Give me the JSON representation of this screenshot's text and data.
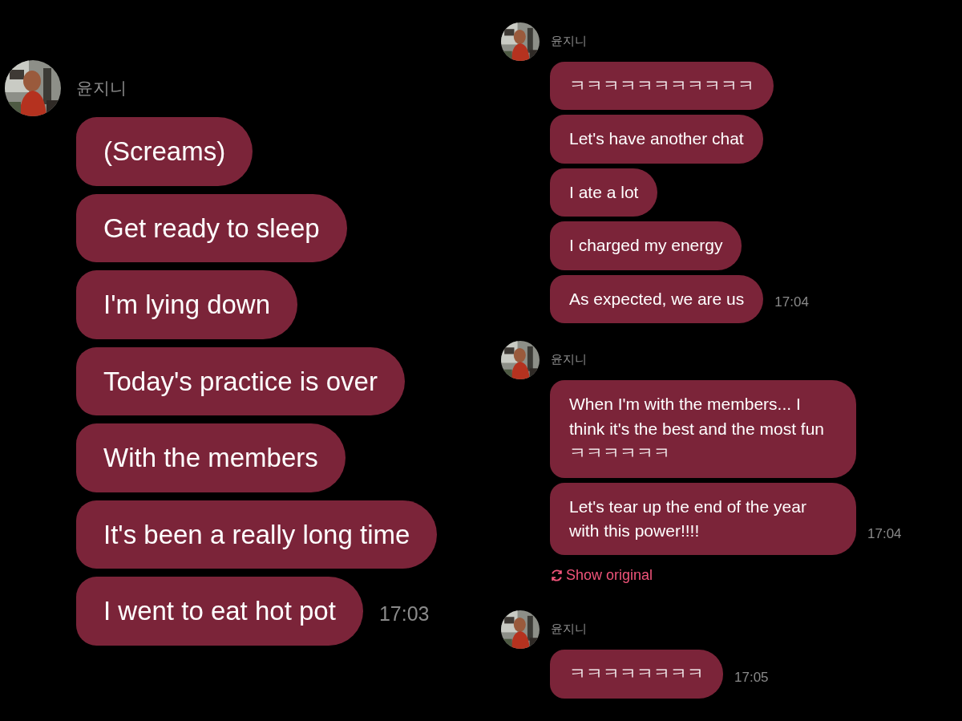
{
  "panels": [
    {
      "kind": "large",
      "groups": [
        {
          "sender": "윤지니",
          "messages": [
            {
              "text": "(Screams)"
            },
            {
              "text": "Get ready to sleep"
            },
            {
              "text": "I'm lying down"
            },
            {
              "text": "Today's practice is over"
            },
            {
              "text": "With the members"
            },
            {
              "text": "It's been a really long time"
            },
            {
              "text": "I went to eat hot pot",
              "time": "17:03"
            }
          ]
        }
      ]
    },
    {
      "kind": "small",
      "groups": [
        {
          "sender": "윤지니",
          "messages": [
            {
              "text": "ㅋㅋㅋㅋㅋㅋㅋㅋㅋㅋㅋ"
            },
            {
              "text": "Let's have another chat"
            },
            {
              "text": "I ate a lot"
            },
            {
              "text": "I charged my energy"
            },
            {
              "text": "As expected, we are us",
              "time": "17:04"
            }
          ]
        },
        {
          "sender": "윤지니",
          "messages": [
            {
              "text": "When I'm with the members... I think it's the best and the most funㅋㅋㅋㅋㅋㅋ"
            },
            {
              "text": "Let's tear up the end of the year with this power!!!!",
              "time": "17:04"
            }
          ],
          "show_original": "Show original"
        },
        {
          "sender": "윤지니",
          "messages": [
            {
              "text": "ㅋㅋㅋㅋㅋㅋㅋㅋ",
              "time": "17:05"
            }
          ]
        }
      ]
    }
  ]
}
